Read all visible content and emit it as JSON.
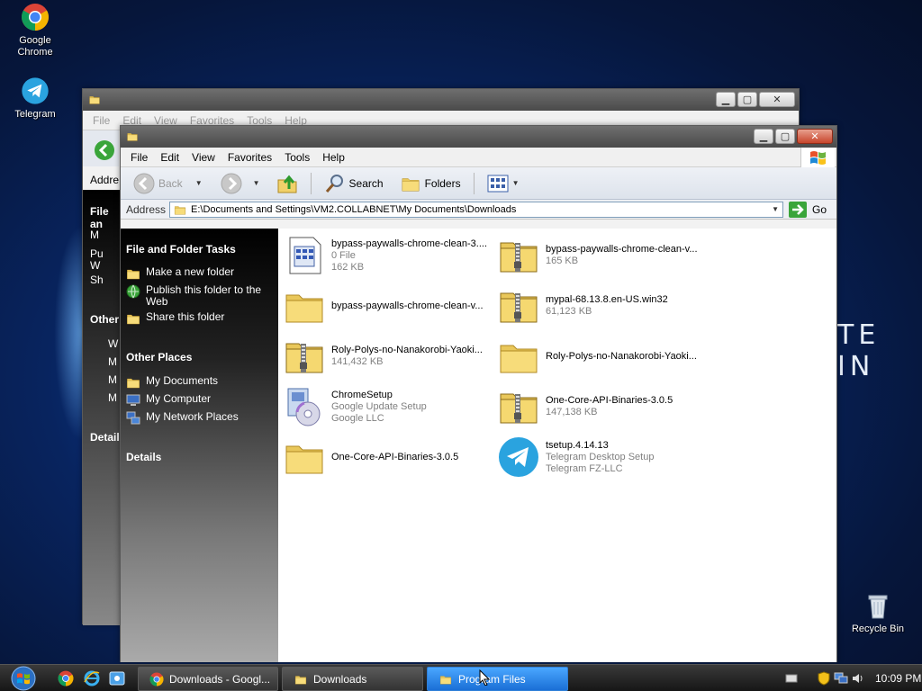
{
  "desktop": {
    "icons": [
      {
        "label_1": "Google",
        "label_2": "Chrome",
        "icon": "chrome-icon"
      },
      {
        "label": "Telegram",
        "icon": "telegram-icon"
      },
      {
        "label": "Recycle Bin",
        "icon": "recycle-bin-icon"
      }
    ],
    "wallpaper_text": "TE IN"
  },
  "back_window": {
    "menu": [
      "File",
      "Edit",
      "View",
      "Favorites",
      "Tools",
      "Help"
    ],
    "address_label": "Addre",
    "tasks_head": "File an",
    "other_head": "Other",
    "details_head": "Details",
    "task_items": [
      "M",
      "Pu",
      "W",
      "Sh"
    ],
    "other_items": [
      "W",
      "M",
      "M",
      "M"
    ]
  },
  "window": {
    "menu": [
      "File",
      "Edit",
      "View",
      "Favorites",
      "Tools",
      "Help"
    ],
    "toolbar": {
      "back": "Back",
      "search": "Search",
      "folders": "Folders"
    },
    "address": {
      "label": "Address",
      "path": "E:\\Documents and Settings\\VM2.COLLABNET\\My Documents\\Downloads",
      "go": "Go"
    },
    "left_pane": {
      "tasks_title": "File and Folder Tasks",
      "tasks": [
        {
          "label": "Make a new folder",
          "icon": "new-folder-icon"
        },
        {
          "label": "Publish this folder to the Web",
          "icon": "publish-web-icon"
        },
        {
          "label": "Share this folder",
          "icon": "share-folder-icon"
        }
      ],
      "places_title": "Other Places",
      "places": [
        {
          "label": "My Documents",
          "icon": "my-documents-icon"
        },
        {
          "label": "My Computer",
          "icon": "my-computer-icon"
        },
        {
          "label": "My Network Places",
          "icon": "network-places-icon"
        }
      ],
      "details_title": "Details"
    },
    "files": [
      {
        "name": "bypass-paywalls-chrome-clean-3....",
        "line2": "0 File",
        "line3": "162 KB",
        "icon": "file-icon"
      },
      {
        "name": "bypass-paywalls-chrome-clean-v...",
        "line2": "165 KB",
        "line3": "",
        "icon": "zip-folder-icon"
      },
      {
        "name": "bypass-paywalls-chrome-clean-v...",
        "line2": "",
        "line3": "",
        "icon": "folder-icon"
      },
      {
        "name": "mypal-68.13.8.en-US.win32",
        "line2": "61,123 KB",
        "line3": "",
        "icon": "zip-folder-icon"
      },
      {
        "name": "Roly-Polys-no-Nanakorobi-Yaoki...",
        "line2": "141,432 KB",
        "line3": "",
        "icon": "zip-folder-icon"
      },
      {
        "name": "Roly-Polys-no-Nanakorobi-Yaoki...",
        "line2": "",
        "line3": "",
        "icon": "folder-icon"
      },
      {
        "name": "ChromeSetup",
        "line2": "Google Update Setup",
        "line3": "Google LLC",
        "icon": "setup-icon"
      },
      {
        "name": "One-Core-API-Binaries-3.0.5",
        "line2": "147,138 KB",
        "line3": "",
        "icon": "zip-folder-icon"
      },
      {
        "name": "One-Core-API-Binaries-3.0.5",
        "line2": "",
        "line3": "",
        "icon": "folder-icon"
      },
      {
        "name": "tsetup.4.14.13",
        "line2": "Telegram Desktop Setup",
        "line3": "Telegram FZ-LLC",
        "icon": "telegram-icon"
      }
    ]
  },
  "taskbar": {
    "buttons": [
      {
        "label": "Downloads - Googl...",
        "icon": "chrome-icon"
      },
      {
        "label": "Downloads",
        "icon": "folder-icon"
      },
      {
        "label": "Program Files",
        "icon": "folder-icon"
      }
    ],
    "clock": "10:09 PM"
  }
}
